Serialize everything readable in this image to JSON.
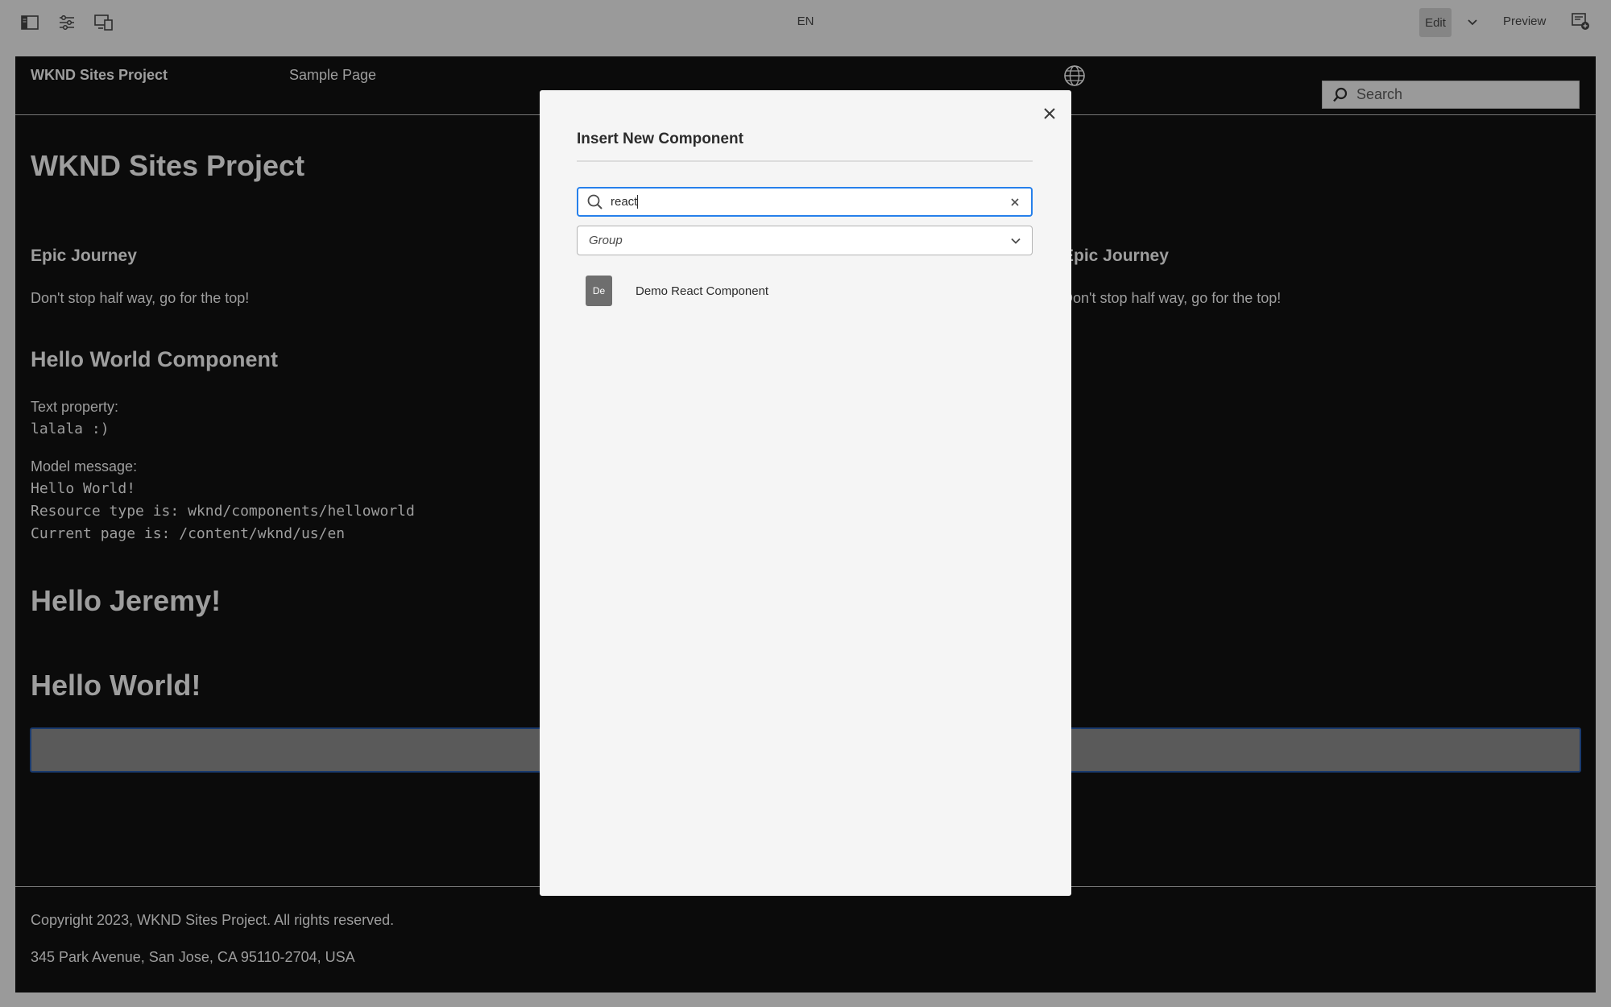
{
  "toolbar": {
    "language": "EN",
    "edit_label": "Edit",
    "preview_label": "Preview",
    "icons": [
      "side-panel-icon",
      "page-properties-icon",
      "emulator-icon",
      "chevron-down-icon",
      "annotations-icon"
    ]
  },
  "page": {
    "brand": "WKND Sites Project",
    "nav_link": "Sample Page",
    "search_placeholder": "Search",
    "title": "WKND Sites Project",
    "teasers": [
      {
        "title": "Epic Journey",
        "text": "Don't stop half way, go for the top!"
      },
      {
        "title": "Epic Journey",
        "text": "Don't stop half way, go for the top!"
      }
    ],
    "helloworld": {
      "title": "Hello World Component",
      "text_property_label": "Text property:",
      "text_property_value": "lalala :)",
      "model_label": "Model message:",
      "model_line1": "Hello World!",
      "model_line2": "Resource type is: wknd/components/helloworld",
      "model_line3": "Current page is:  /content/wknd/us/en"
    },
    "heading1": "Hello Jeremy!",
    "heading2": "Hello World!",
    "footer_copyright": "Copyright 2023, WKND Sites Project. All rights reserved.",
    "footer_address": "345 Park Avenue, San Jose, CA 95110-2704, USA"
  },
  "dialog": {
    "title": "Insert New Component",
    "search_value": "react",
    "group_placeholder": "Group",
    "results": [
      {
        "badge": "De",
        "label": "Demo React Component"
      }
    ]
  }
}
